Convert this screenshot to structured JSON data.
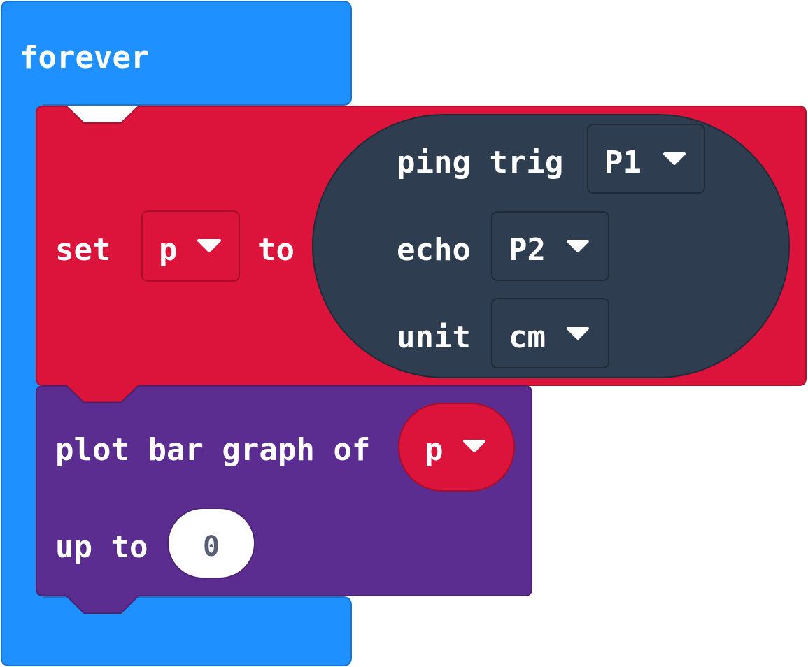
{
  "forever_block": {
    "label": "forever",
    "color": "#1e90ff",
    "border": "#1873cc"
  },
  "set_block": {
    "keyword_set": "set",
    "variable": "p",
    "keyword_to": "to",
    "color": "#dc143c",
    "border": "#b0102f"
  },
  "ping_block": {
    "keyword_ping": "ping trig",
    "trig_pin": "P1",
    "keyword_echo": "echo",
    "echo_pin": "P2",
    "keyword_unit": "unit",
    "unit": "cm",
    "color": "#2e3e50",
    "border": "#1f2b38"
  },
  "plot_block": {
    "keyword_plot": "plot bar graph of",
    "value_variable": "p",
    "keyword_up_to": "up to",
    "max_value": "0",
    "color": "#5c2d91",
    "border": "#4a2474"
  },
  "dropdown_arrow": "caret-down-icon"
}
